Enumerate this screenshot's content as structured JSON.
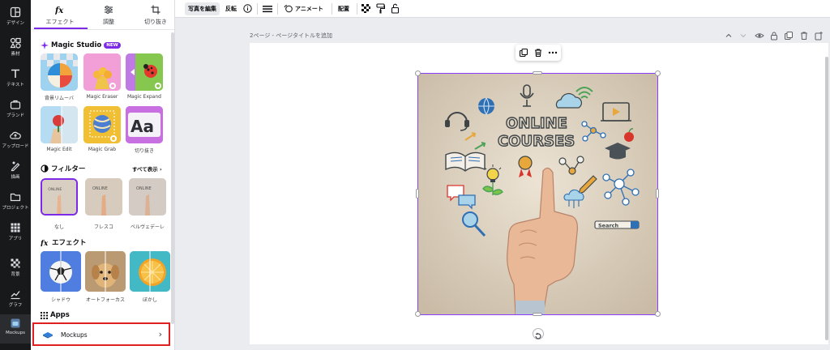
{
  "rail": {
    "items": [
      {
        "label": "デザイン",
        "icon": "layout-icon"
      },
      {
        "label": "素材",
        "icon": "elements-icon"
      },
      {
        "label": "テキスト",
        "icon": "text-icon"
      },
      {
        "label": "ブランド",
        "icon": "brand-icon"
      },
      {
        "label": "アップロード",
        "icon": "upload-icon"
      },
      {
        "label": "描画",
        "icon": "draw-icon"
      },
      {
        "label": "プロジェクト",
        "icon": "folder-icon"
      },
      {
        "label": "アプリ",
        "icon": "apps-grid-icon"
      },
      {
        "label": "背景",
        "icon": "background-icon"
      },
      {
        "label": "グラフ",
        "icon": "chart-icon"
      },
      {
        "label": "Mockups",
        "icon": "mockups-icon"
      }
    ]
  },
  "panel": {
    "tabs": [
      {
        "label": "エフェクト",
        "icon": "fx-icon"
      },
      {
        "label": "調整",
        "icon": "sliders-icon"
      },
      {
        "label": "切り抜き",
        "icon": "crop-icon"
      }
    ],
    "magic_studio": {
      "title": "Magic Studio",
      "badge": "NEW",
      "items": [
        {
          "label": "背景リムーバ"
        },
        {
          "label": "Magic Eraser"
        },
        {
          "label": "Magic Expand"
        },
        {
          "label": "Magic Edit"
        },
        {
          "label": "Magic Grab"
        },
        {
          "label": "切り抜き"
        }
      ]
    },
    "filters": {
      "title": "フィルター",
      "see_all": "すべて表示",
      "items": [
        {
          "label": "なし"
        },
        {
          "label": "フレスコ"
        },
        {
          "label": "ベルヴェデーレ"
        }
      ]
    },
    "effects": {
      "title": "エフェクト",
      "items": [
        {
          "label": "シャドウ"
        },
        {
          "label": "オートフォーカス"
        },
        {
          "label": "ぼかし"
        }
      ]
    },
    "apps": {
      "title": "Apps",
      "mockups_label": "Mockups"
    }
  },
  "toolbar": {
    "edit_photo": "写真を編集",
    "flip": "反転",
    "animate": "アニメート",
    "position": "配置"
  },
  "canvas": {
    "page_title": "2ページ - ページタイトルを追加",
    "image_text_line1": "ONLINE",
    "image_text_line2": "COURSES",
    "image_search_label": "Search"
  },
  "colors": {
    "accent": "#7d2ae8",
    "highlight_box": "#e02020",
    "rail_bg": "#18191b"
  }
}
